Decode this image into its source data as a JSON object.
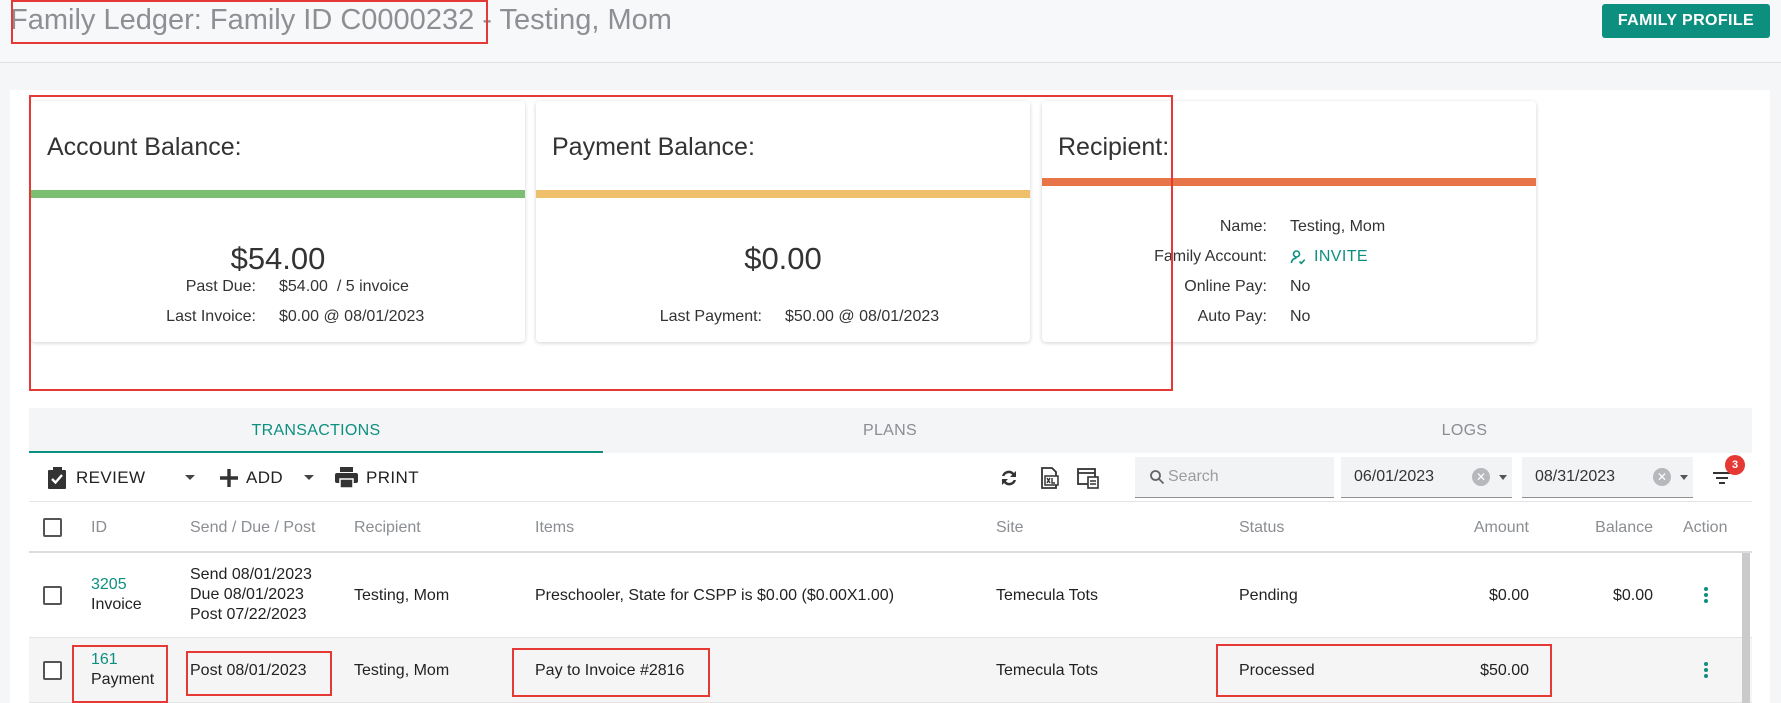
{
  "header": {
    "title": "Family Ledger: Family ID C0000232 - Testing, Mom",
    "profile_button": "FAMILY PROFILE"
  },
  "account_balance": {
    "title": "Account Balance:",
    "amount": "$54.00",
    "past_due_label": "Past Due:",
    "past_due_value": "$54.00  / 5 invoice",
    "last_invoice_label": "Last Invoice:",
    "last_invoice_value": "$0.00 @ 08/01/2023",
    "bar_color": "#7dbf72"
  },
  "payment_balance": {
    "title": "Payment Balance:",
    "amount": "$0.00",
    "last_payment_label": "Last Payment:",
    "last_payment_value": "$50.00 @ 08/01/2023",
    "bar_color": "#eec06b"
  },
  "recipient": {
    "title": "Recipient:",
    "bar_color": "#e8744a",
    "name_label": "Name:",
    "name_value": "Testing, Mom",
    "family_account_label": "Family Account:",
    "invite_label": "INVITE",
    "online_pay_label": "Online Pay:",
    "online_pay_value": "No",
    "auto_pay_label": "Auto Pay:",
    "auto_pay_value": "No"
  },
  "tabs": [
    "TRANSACTIONS",
    "PLANS",
    "LOGS"
  ],
  "toolbar": {
    "review": "REVIEW",
    "add": "ADD",
    "print": "PRINT",
    "search_placeholder": "Search",
    "date_from": "06/01/2023",
    "date_to": "08/31/2023",
    "filter_count": "3"
  },
  "columns": [
    "ID",
    "Send / Due / Post",
    "Recipient",
    "Items",
    "Site",
    "Status",
    "Amount",
    "Balance",
    "Action"
  ],
  "rows": [
    {
      "id": "3205",
      "type": "Invoice",
      "dates": [
        "Send 08/01/2023",
        "Due 08/01/2023",
        "Post 07/22/2023"
      ],
      "recipient": "Testing, Mom",
      "items": "Preschooler, State for CSPP is $0.00 ($0.00X1.00)",
      "site": "Temecula Tots",
      "status": "Pending",
      "amount": "$0.00",
      "balance": "$0.00"
    },
    {
      "id": "161",
      "type": "Payment",
      "dates": [
        "Post 08/01/2023"
      ],
      "recipient": "Testing, Mom",
      "items": "Pay to Invoice #2816",
      "site": "Temecula Tots",
      "status": "Processed",
      "amount": "$50.00",
      "balance": ""
    }
  ]
}
